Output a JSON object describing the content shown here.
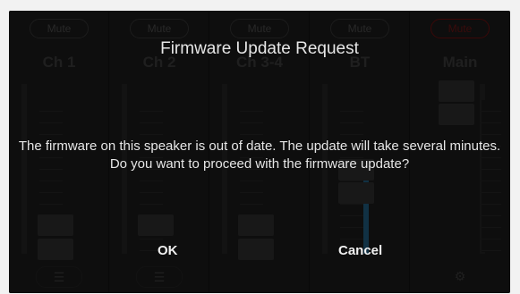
{
  "channels": [
    {
      "mute_label": "Mute",
      "name": "Ch 1",
      "icon": "sliders-icon"
    },
    {
      "mute_label": "Mute",
      "name": "Ch 2",
      "icon": "sliders-icon"
    },
    {
      "mute_label": "Mute",
      "name": "Ch 3-4",
      "icon": "sliders-icon"
    },
    {
      "mute_label": "Mute",
      "name": "BT",
      "icon": "sliders-icon"
    },
    {
      "mute_label": "Mute",
      "name": "Main",
      "icon": "gear-icon"
    }
  ],
  "dialog": {
    "title": "Firmware Update Request",
    "message": "The firmware on this speaker is out of date. The update will take several minutes. Do you want to proceed with the firmware update?",
    "ok_label": "OK",
    "cancel_label": "Cancel"
  },
  "colors": {
    "background": "#141414",
    "text": "#e6e6e6",
    "main_mute": "#8b1a1a",
    "bt_fader": "#2a7fb0"
  }
}
